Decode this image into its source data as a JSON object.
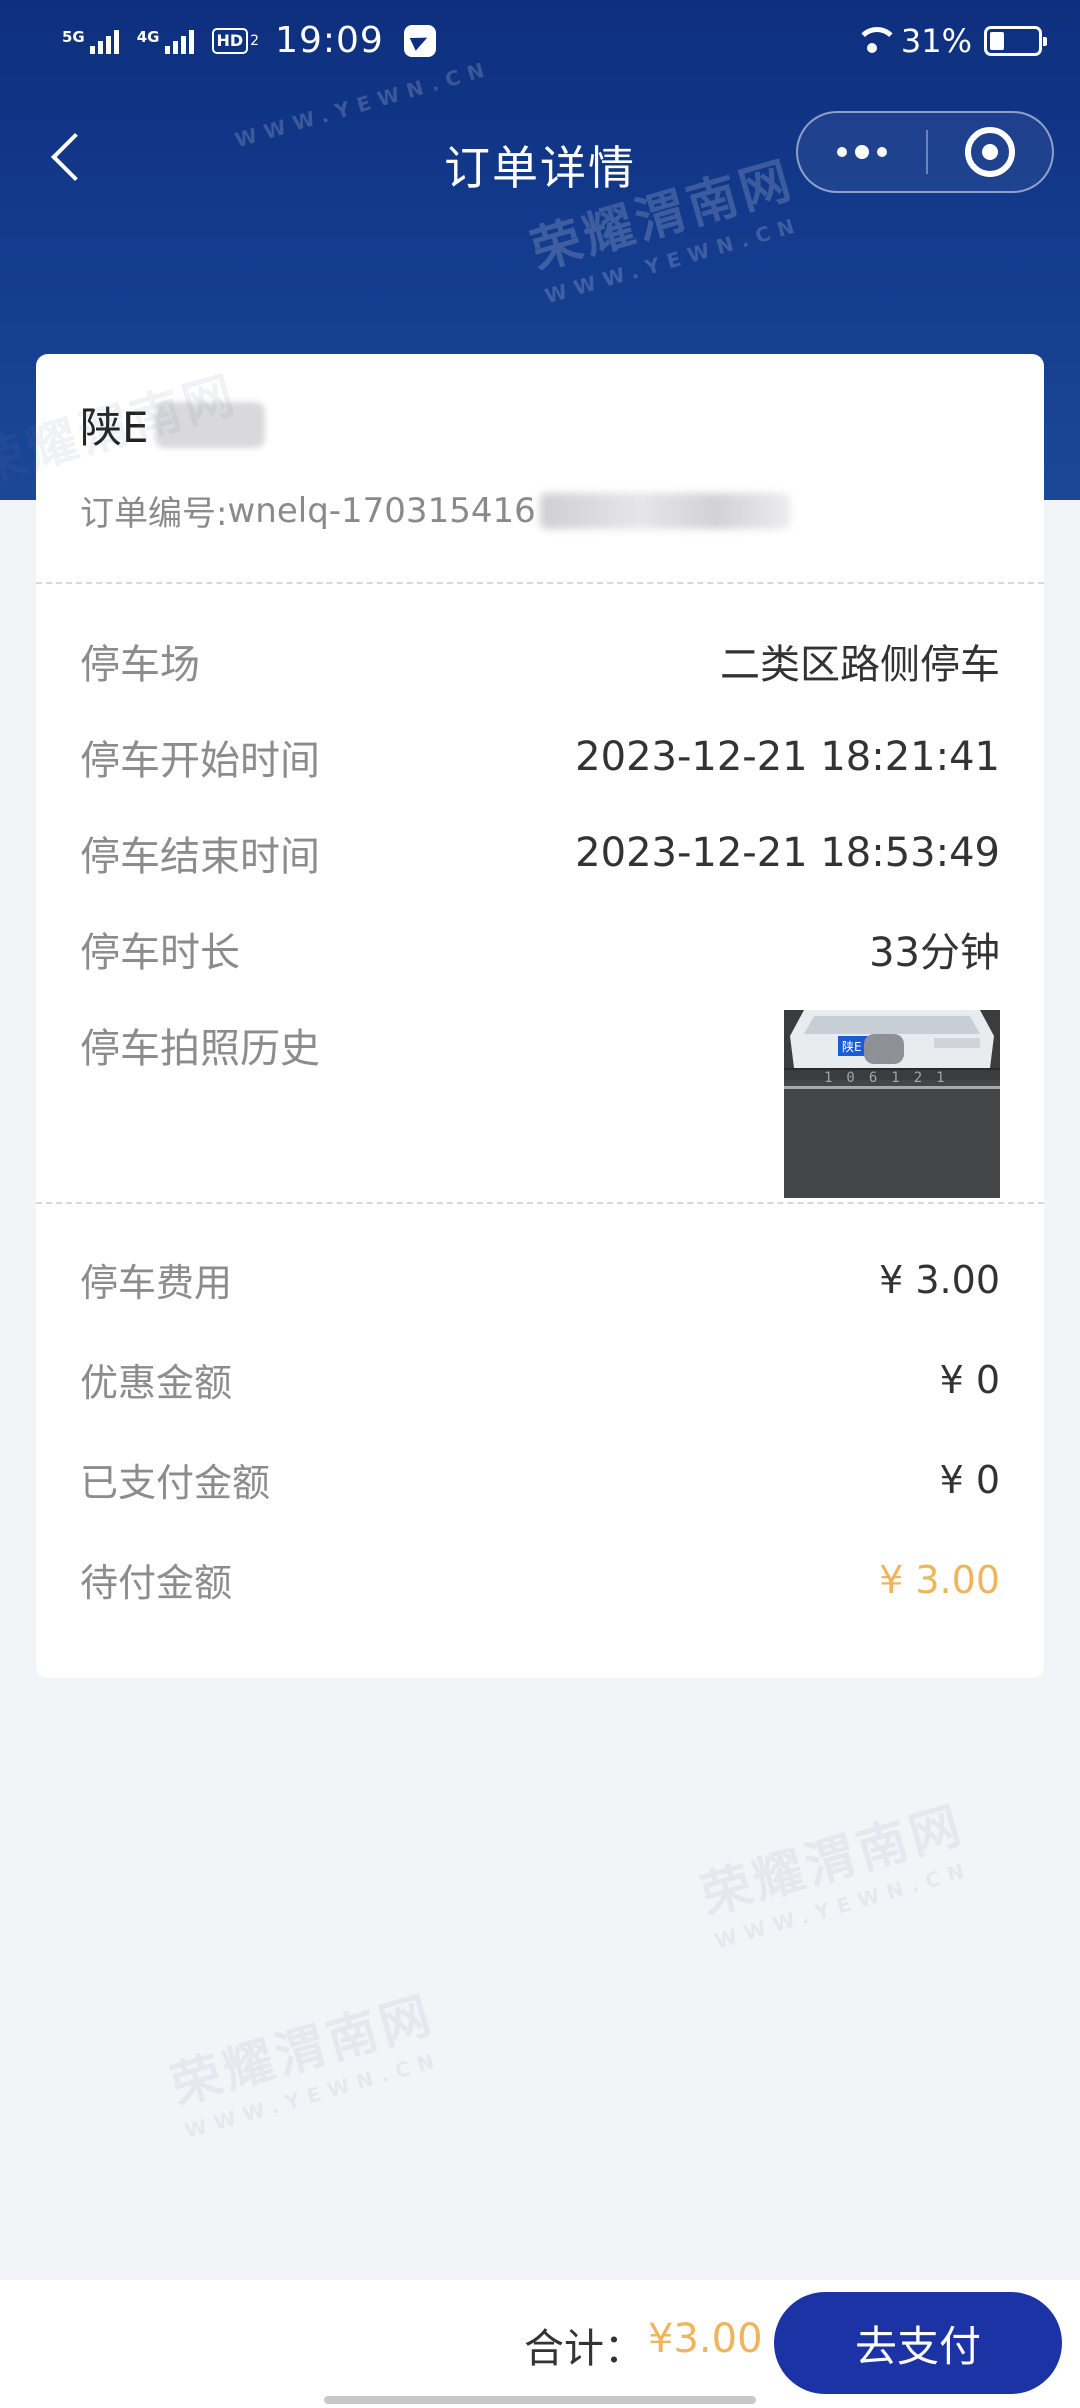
{
  "status_bar": {
    "network_1": "5G",
    "network_2": "4G",
    "hd_label": "HD",
    "hd_sub": "2",
    "time": "19:09",
    "battery_percent": "31%",
    "battery_level": 0.31
  },
  "nav": {
    "title": "订单详情"
  },
  "order": {
    "plate_prefix": "陕E",
    "order_no_label": "订单编号: ",
    "order_no_visible": "wnelq-170315416"
  },
  "details": [
    {
      "label": "停车场",
      "value": "二类区路侧停车"
    },
    {
      "label": "停车开始时间",
      "value": "2023-12-21 18:21:41"
    },
    {
      "label": "停车结束时间",
      "value": "2023-12-21 18:53:49"
    },
    {
      "label": "停车时长",
      "value": "33分钟"
    },
    {
      "label": "停车拍照历史",
      "value": ""
    }
  ],
  "fees": [
    {
      "label": "停车费用",
      "value": "¥ 3.00"
    },
    {
      "label": "优惠金额",
      "value": "¥ 0"
    },
    {
      "label": "已支付金额",
      "value": "¥ 0"
    },
    {
      "label": "待付金额",
      "value": "¥ 3.00"
    }
  ],
  "photo": {
    "plate_text": "陕E"
  },
  "bottom": {
    "total_label": "合计：",
    "total_amount": "¥3.00",
    "pay_label": "去支付"
  },
  "watermark": {
    "cn": "荣耀渭南网",
    "en": "WWW.YEWN.CN"
  },
  "colors": {
    "header": "#133a8c",
    "accent_orange": "#f0b45d",
    "pay_button": "#1c33a6",
    "background": "#f2f4f7"
  }
}
